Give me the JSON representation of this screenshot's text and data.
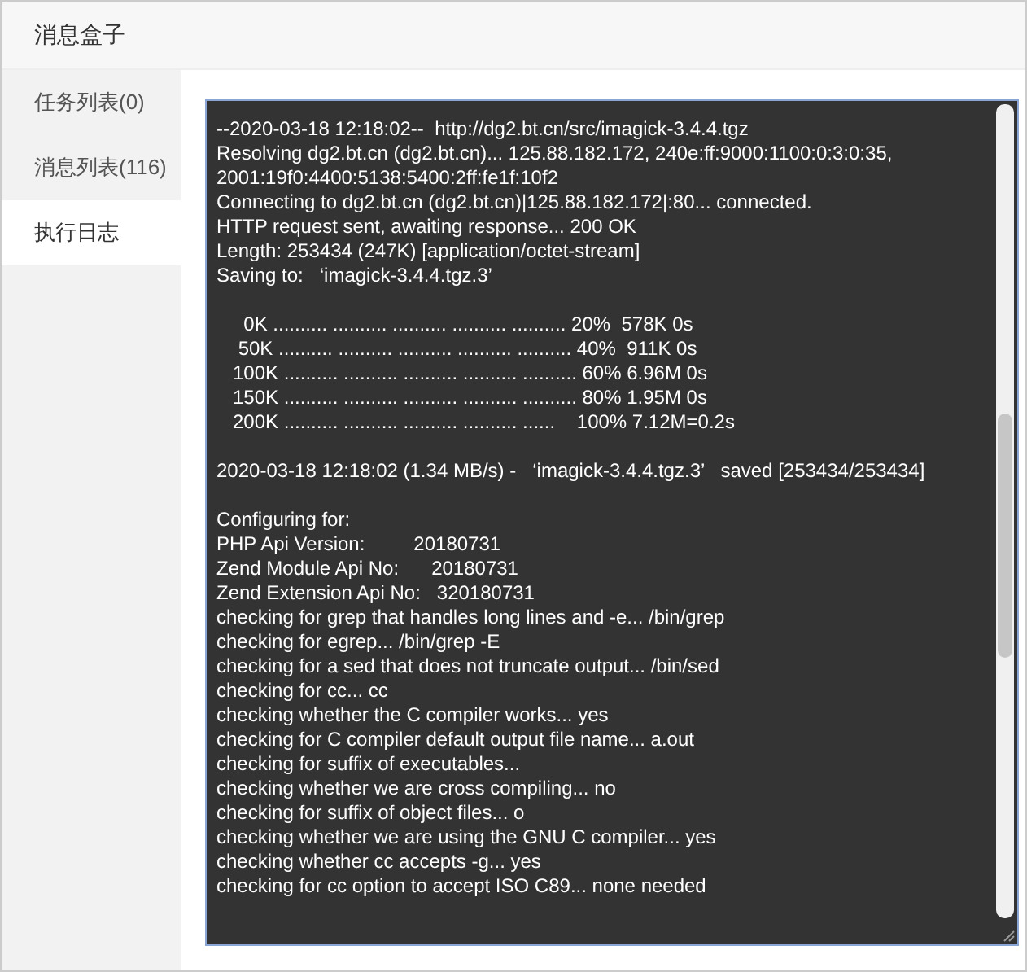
{
  "window": {
    "title": "消息盒子"
  },
  "tabs": [
    {
      "label": "任务列表(0)",
      "selected": false
    },
    {
      "label": "消息列表(116)",
      "selected": false
    },
    {
      "label": "执行日志",
      "selected": true
    }
  ],
  "log": {
    "blocks": [
      [
        "--2020-03-18 12:18:02--  http://dg2.bt.cn/src/imagick-3.4.4.tgz",
        "Resolving dg2.bt.cn (dg2.bt.cn)... 125.88.182.172, 240e:ff:9000:1100:0:3:0:35,",
        "2001:19f0:4400:5138:5400:2ff:fe1f:10f2",
        "Connecting to dg2.bt.cn (dg2.bt.cn)|125.88.182.172|:80... connected.",
        "HTTP request sent, awaiting response... 200 OK",
        "Length: 253434 (247K) [application/octet-stream]",
        "Saving to:   ‘imagick-3.4.4.tgz.3’"
      ],
      [
        "     0K .......... .......... .......... .......... .......... 20%  578K 0s",
        "    50K .......... .......... .......... .......... .......... 40%  911K 0s",
        "   100K .......... .......... .......... .......... .......... 60% 6.96M 0s",
        "   150K .......... .......... .......... .......... .......... 80% 1.95M 0s",
        "   200K .......... .......... .......... .......... ......    100% 7.12M=0.2s"
      ],
      [
        "2020-03-18 12:18:02 (1.34 MB/s) -   ‘imagick-3.4.4.tgz.3’   saved [253434/253434]"
      ],
      [
        "Configuring for:",
        "PHP Api Version:         20180731",
        "Zend Module Api No:      20180731",
        "Zend Extension Api No:   320180731",
        "checking for grep that handles long lines and -e... /bin/grep",
        "checking for egrep... /bin/grep -E",
        "checking for a sed that does not truncate output... /bin/sed",
        "checking for cc... cc",
        "checking whether the C compiler works... yes",
        "checking for C compiler default output file name... a.out",
        "checking for suffix of executables...",
        "checking whether we are cross compiling... no",
        "checking for suffix of object files... o",
        "checking whether we are using the GNU C compiler... yes",
        "checking whether cc accepts -g... yes",
        "checking for cc option to accept ISO C89... none needed"
      ]
    ]
  }
}
